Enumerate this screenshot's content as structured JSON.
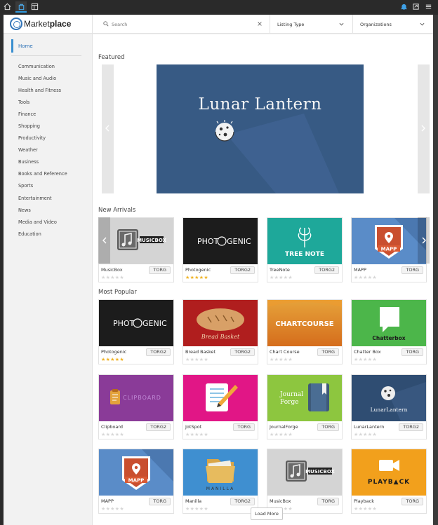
{
  "colors": {
    "accent": "#3a8fd0",
    "star_on": "#f0b326",
    "star_off": "#d7d7d7",
    "featured_bg": "#375a84"
  },
  "system_bar": {
    "icons": [
      "home-icon",
      "store-icon",
      "window-icon",
      "notification-icon",
      "share-icon",
      "menu-icon"
    ]
  },
  "brand": {
    "name_light": "Market",
    "name_bold": "place"
  },
  "filters": {
    "search_placeholder": "Search",
    "listing_type": "Listing Type",
    "organizations": "Organizations"
  },
  "sidebar": {
    "home": "Home",
    "categories": [
      "Communication",
      "Music and Audio",
      "Health and Fitness",
      "Tools",
      "Finance",
      "Shopping",
      "Productivity",
      "Weather",
      "Business",
      "Books and Reference",
      "Sports",
      "Entertainment",
      "News",
      "Media and Video",
      "Education"
    ]
  },
  "featured": {
    "section_title": "Featured",
    "banner_title": "Lunar Lantern"
  },
  "new_arrivals": {
    "section_title": "New Arrivals",
    "cards": [
      {
        "name": "MusicBox",
        "org": "TORG",
        "rating": 0,
        "art": "musicbox"
      },
      {
        "name": "Photogenic",
        "org": "TORG2",
        "rating": 5,
        "art": "photogenic"
      },
      {
        "name": "TreeNote",
        "org": "TORG2",
        "rating": 0,
        "art": "treenote"
      },
      {
        "name": "MAPP",
        "org": "TORG",
        "rating": 0,
        "art": "mapp"
      }
    ]
  },
  "most_popular": {
    "section_title": "Most Popular",
    "cards": [
      {
        "name": "Photogenic",
        "org": "TORG2",
        "rating": 5,
        "art": "photogenic"
      },
      {
        "name": "Bread Basket",
        "org": "TORG2",
        "rating": 0,
        "art": "breadbasket"
      },
      {
        "name": "Chart Course",
        "org": "TORG",
        "rating": 0,
        "art": "chartcourse"
      },
      {
        "name": "Chatter Box",
        "org": "TORG",
        "rating": 0,
        "art": "chatterbox"
      },
      {
        "name": "Clipboard",
        "org": "TORG2",
        "rating": 0,
        "art": "clipboard"
      },
      {
        "name": "JotSpot",
        "org": "TORG",
        "rating": 0,
        "art": "jotspot"
      },
      {
        "name": "JournalForge",
        "org": "TORG",
        "rating": 0,
        "art": "journalforge"
      },
      {
        "name": "LunarLantern",
        "org": "TORG2",
        "rating": 0,
        "art": "lunarlantern"
      },
      {
        "name": "MAPP",
        "org": "TORG",
        "rating": 0,
        "art": "mapp"
      },
      {
        "name": "Manilla",
        "org": "TORG2",
        "rating": 0,
        "art": "manilla"
      },
      {
        "name": "MusicBox",
        "org": "TORG",
        "rating": 0,
        "art": "musicbox"
      },
      {
        "name": "Playback",
        "org": "TORG",
        "rating": 0,
        "art": "playback"
      }
    ]
  },
  "art_text": {
    "musicbox": "MUSICBOX",
    "photogenic_a": "PHOT",
    "photogenic_b": "GENIC",
    "treenote": "TREE NOTE",
    "mapp": "MAPP",
    "breadbasket": "Bread Basket",
    "chartcourse": "CHARTCOURSE",
    "chatterbox": "Chatterbox",
    "clipboard": "CLIPBOARD",
    "journalforge_a": "Journal",
    "journalforge_b": "Forge",
    "lunarlantern": "LunarLantern",
    "manilla": "MANILLA",
    "playback": "PLAYB▲CK"
  },
  "load_more": "Load More"
}
